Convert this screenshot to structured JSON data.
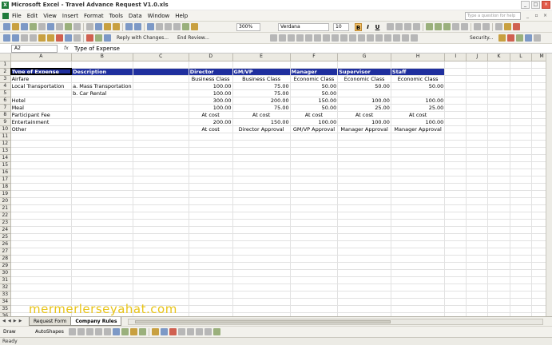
{
  "window": {
    "title": "Microsoft Excel - Travel Advance Request V1.0.xls",
    "app_icon": "excel-icon",
    "help_placeholder": "Type a question for help"
  },
  "menu": [
    "File",
    "Edit",
    "View",
    "Insert",
    "Format",
    "Tools",
    "Data",
    "Window",
    "Help"
  ],
  "toolbar": {
    "zoom": "300%",
    "font": "Verdana",
    "font_size": "10",
    "reply_changes": "Reply with Changes...",
    "end_review": "End Review...",
    "security": "Security..."
  },
  "formula_bar": {
    "name_box": "A2",
    "fx": "fx",
    "content": "Type of Expense"
  },
  "columns": [
    "A",
    "B",
    "C",
    "D",
    "E",
    "F",
    "G",
    "H",
    "I",
    "J",
    "K",
    "L",
    "M"
  ],
  "header_row": [
    "Type of Expense",
    "Description",
    "",
    "Director",
    "GM/VP",
    "Manager",
    "Supervisor",
    "Staff"
  ],
  "rows": [
    [
      "Airfare",
      "",
      "",
      "Business Class",
      "Business Class",
      "Economic Class",
      "Economic Class",
      "Economic Class"
    ],
    [
      "Local Transportation",
      "a. Mass Transportation",
      "",
      "100.00",
      "75.00",
      "50.00",
      "50.00",
      "50.00"
    ],
    [
      "",
      "b. Car Rental",
      "",
      "100.00",
      "75.00",
      "50.00",
      "",
      ""
    ],
    [
      "Hotel",
      "",
      "",
      "300.00",
      "200.00",
      "150.00",
      "100.00",
      "100.00"
    ],
    [
      "Meal",
      "",
      "",
      "100.00",
      "75.00",
      "50.00",
      "25.00",
      "25.00"
    ],
    [
      "Participant Fee",
      "",
      "",
      "At cost",
      "At cost",
      "At cost",
      "At cost",
      "At cost"
    ],
    [
      "Entertainment",
      "",
      "",
      "200.00",
      "150.00",
      "100.00",
      "100.00",
      "100.00"
    ],
    [
      "Other",
      "",
      "",
      "At cost",
      "Director Approval",
      "GM/VP Approval",
      "Manager Approval",
      "Manager Approval"
    ]
  ],
  "total_rows": 36,
  "sheet_tabs": [
    {
      "label": "Request Form",
      "active": false
    },
    {
      "label": "Company Rules",
      "active": true
    }
  ],
  "draw_toolbar": {
    "draw": "Draw",
    "autoshapes": "AutoShapes"
  },
  "status": "Ready",
  "watermark": "mermerlerseyahat.com",
  "colors": {
    "header_fill": "#1f2f9e",
    "selection": "#f6c36b",
    "watermark": "#e8c419"
  }
}
